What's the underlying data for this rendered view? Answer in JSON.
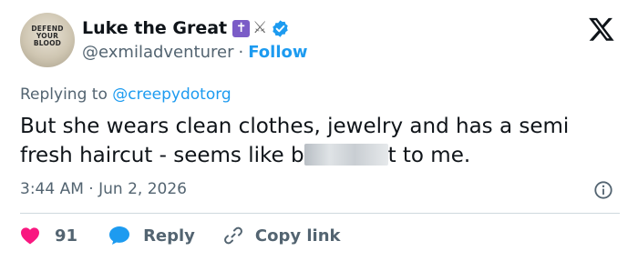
{
  "user": {
    "display_name": "Luke the Great",
    "handle": "@exmiladventurer",
    "separator": "·",
    "follow_label": "Follow",
    "avatar_text": [
      "DEFEND",
      "YOUR",
      "BLOOD"
    ],
    "name_emojis": [
      "✝",
      "⚔"
    ]
  },
  "tweet": {
    "replying_prefix": "Replying to",
    "replying_to": "@creepydotorg",
    "text_before": "But she wears clean clothes, jewelry and has a semi fresh haircut - seems like b",
    "text_after": "t to me.",
    "time": "3:44 AM",
    "date_separator": "·",
    "date": "Jun 2, 2026"
  },
  "actions": {
    "like_count": "91",
    "reply_label": "Reply",
    "copy_link_label": "Copy link"
  },
  "colors": {
    "accent": "#1d9bf0",
    "like": "#f91880",
    "text": "#0f1419",
    "muted": "#536471",
    "divider": "#cfd9de"
  },
  "icons": {
    "brand": "x-logo-icon",
    "verified": "verified-badge-icon",
    "info": "info-icon",
    "like": "heart-icon",
    "reply": "reply-bubble-icon",
    "copy": "link-icon"
  }
}
